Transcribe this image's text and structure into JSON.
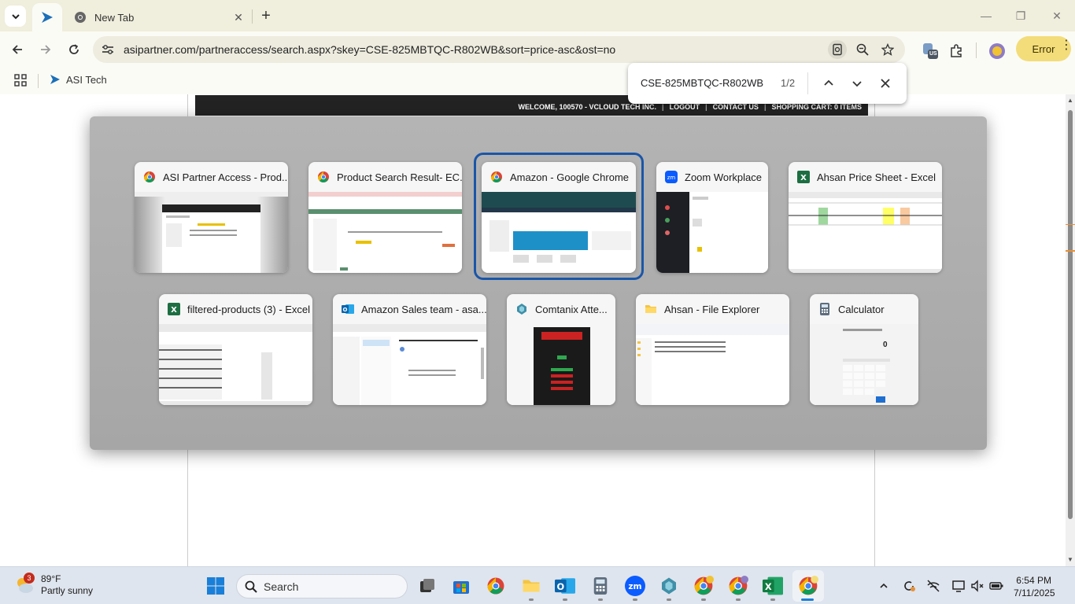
{
  "browser": {
    "tab_title": "New Tab",
    "url": "asipartner.com/partneraccess/search.aspx?skey=CSE-825MBTQC-R802WB&sort=price-asc&ost=no",
    "error_label": "Error",
    "profile_ext_badge": "US",
    "bookmark_label": "ASI Tech"
  },
  "findbar": {
    "query": "CSE-825MBTQC-R802WB",
    "count": "1/2"
  },
  "site": {
    "nav": [
      "WELCOME, 100570 - VCLOUD TECH INC.",
      "LOGOUT",
      "CONTACT US",
      "SHOPPING CART: 0 ITEMS"
    ]
  },
  "switcher": {
    "windows": [
      {
        "title": "ASI Partner Access - Prod...",
        "icon": "chrome-icon"
      },
      {
        "title": "Product Search Result- EC...",
        "icon": "chrome-icon"
      },
      {
        "title": "Amazon - Google Chrome",
        "icon": "chrome-icon",
        "selected": true
      },
      {
        "title": "Zoom Workplace",
        "icon": "zoom-icon"
      },
      {
        "title": "Ahsan Price Sheet - Excel",
        "icon": "excel-icon"
      },
      {
        "title": "filtered-products (3) - Excel",
        "icon": "excel-icon"
      },
      {
        "title": "Amazon Sales team - asa...",
        "icon": "outlook-icon"
      },
      {
        "title": "Comtanix Atte...",
        "icon": "app-icon"
      },
      {
        "title": "Ahsan - File Explorer",
        "icon": "folder-icon"
      },
      {
        "title": "Calculator",
        "icon": "calculator-icon"
      }
    ],
    "calculator_display": "0"
  },
  "taskbar": {
    "weather_temp": "89°F",
    "weather_desc": "Partly sunny",
    "weather_badge": "3",
    "search_label": "Search",
    "time": "6:54 PM",
    "date": "7/11/2025"
  },
  "colors": {
    "selection": "#1a56a8",
    "error_pill": "#f3dd7a",
    "tabstrip": "#f0eedc"
  }
}
